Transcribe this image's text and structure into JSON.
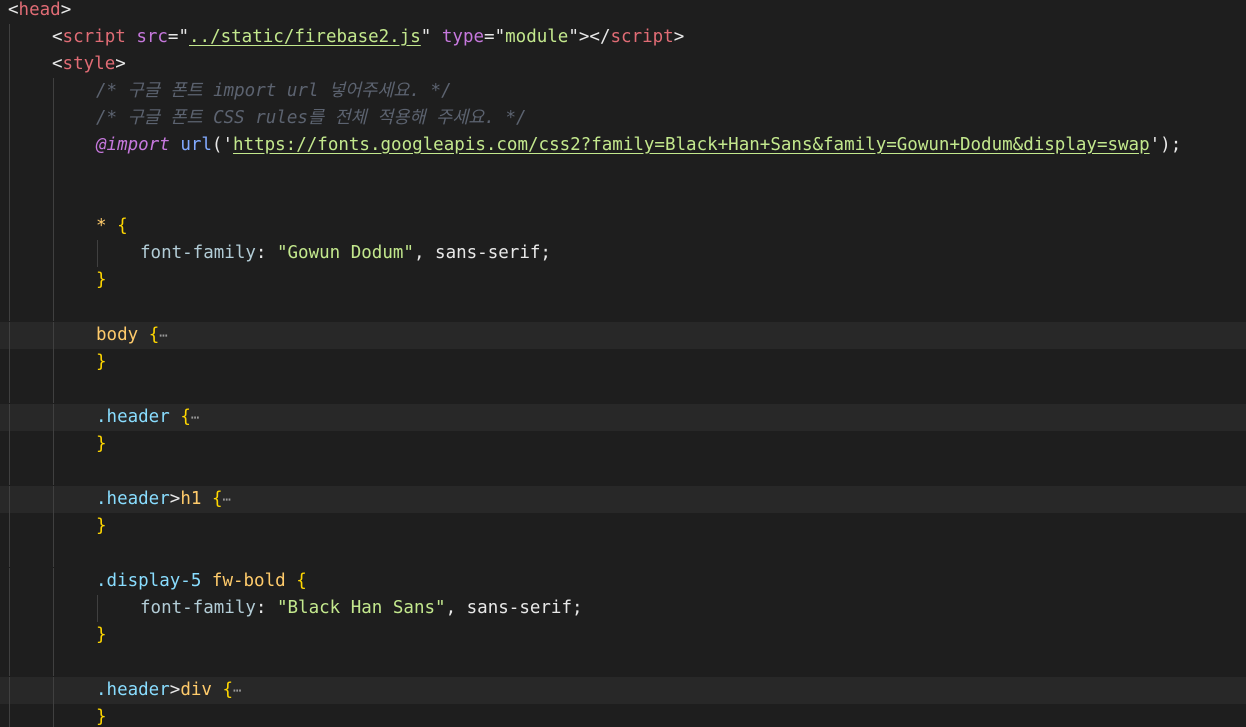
{
  "editor": {
    "lines": {
      "l0": [
        "<",
        "head",
        ">"
      ],
      "l1": [
        "<",
        "script",
        " ",
        "src",
        "=\"",
        "../static/firebase2.js",
        "\"",
        " ",
        "type",
        "=\"",
        "module",
        "\"",
        "></",
        "script",
        ">"
      ],
      "l2": [
        "<",
        "style",
        ">"
      ],
      "l3": "/* 구글 폰트 import url 넣어주세요. */",
      "l4": "/* 구글 폰트 CSS rules를 전체 적용해 주세요. */",
      "l5": [
        "@import",
        " ",
        "url",
        "('",
        "https://fonts.googleapis.com/css2?family=Black+Han+Sans&family=Gowun+Dodum&display=swap",
        "');"
      ],
      "l8": [
        "*",
        " ",
        "{"
      ],
      "l9": [
        "font-family",
        ": ",
        "\"Gowun Dodum\"",
        ", ",
        "sans-serif",
        ";"
      ],
      "l10": "}",
      "l12": [
        "body",
        " ",
        "{",
        "⋯"
      ],
      "l13": "}",
      "l15": [
        ".header",
        " ",
        "{",
        "⋯"
      ],
      "l16": "}",
      "l18": [
        ".header",
        ">",
        "h1",
        " ",
        "{",
        "⋯"
      ],
      "l19": "}",
      "l21": [
        ".display-5",
        " ",
        "fw-bold",
        " ",
        "{"
      ],
      "l22": [
        "font-family",
        ": ",
        "\"Black Han Sans\"",
        ", ",
        "sans-serif",
        ";"
      ],
      "l23": "}",
      "l25": [
        ".header",
        ">",
        "div",
        " ",
        "{",
        "⋯"
      ],
      "l26": "}"
    }
  }
}
